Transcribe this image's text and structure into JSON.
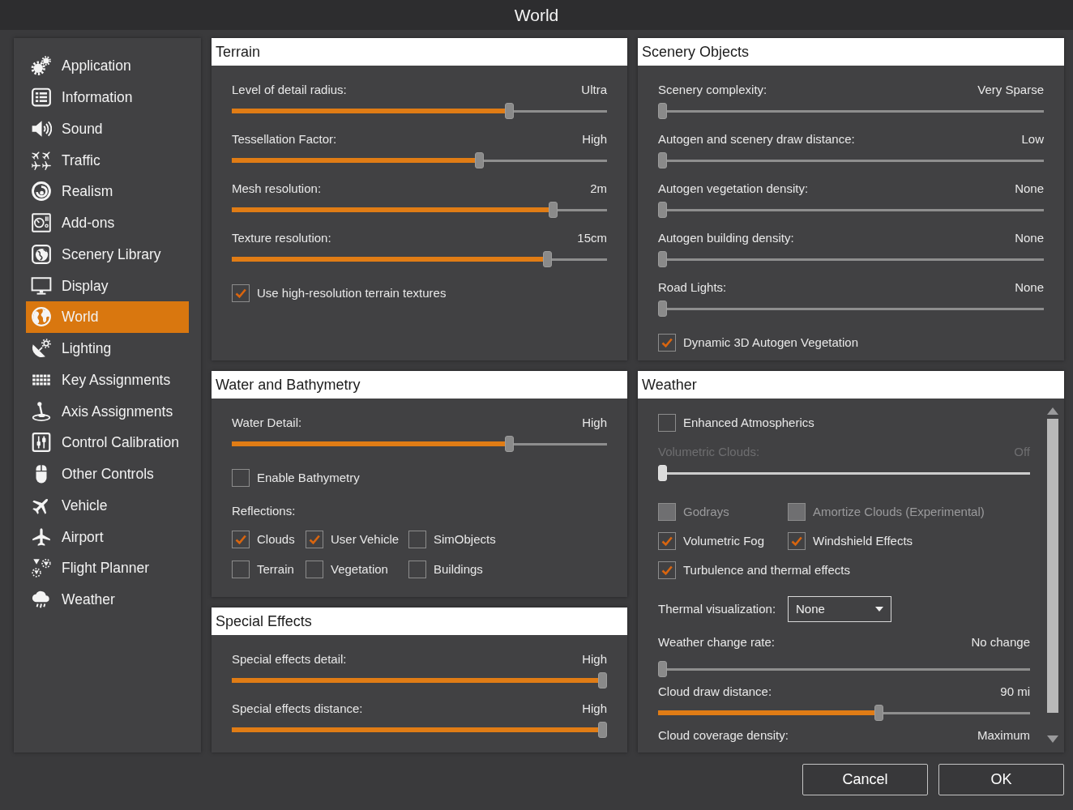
{
  "window": {
    "title": "World"
  },
  "sidebar": {
    "items": [
      {
        "label": "Application",
        "selected": false
      },
      {
        "label": "Information",
        "selected": false
      },
      {
        "label": "Sound",
        "selected": false
      },
      {
        "label": "Traffic",
        "selected": false
      },
      {
        "label": "Realism",
        "selected": false
      },
      {
        "label": "Add-ons",
        "selected": false
      },
      {
        "label": "Scenery Library",
        "selected": false
      },
      {
        "label": "Display",
        "selected": false
      },
      {
        "label": "World",
        "selected": true
      },
      {
        "label": "Lighting",
        "selected": false
      },
      {
        "label": "Key Assignments",
        "selected": false
      },
      {
        "label": "Axis Assignments",
        "selected": false
      },
      {
        "label": "Control Calibration",
        "selected": false
      },
      {
        "label": "Other Controls",
        "selected": false
      },
      {
        "label": "Vehicle",
        "selected": false
      },
      {
        "label": "Airport",
        "selected": false
      },
      {
        "label": "Flight Planner",
        "selected": false
      },
      {
        "label": "Weather",
        "selected": false
      }
    ]
  },
  "columns": [
    {
      "panels": [
        {
          "title": "Terrain",
          "controls": [
            {
              "kind": "slider",
              "label": "Level of detail radius:",
              "value": "Ultra",
              "level": 0.745
            },
            {
              "kind": "slider",
              "label": "Tessellation Factor:",
              "value": "High",
              "level": 0.663
            },
            {
              "kind": "slider",
              "label": "Mesh resolution:",
              "value": "2m",
              "level": 0.866
            },
            {
              "kind": "slider",
              "label": "Texture resolution:",
              "value": "15cm",
              "level": 0.849
            },
            {
              "kind": "checkbox",
              "label": "Use high-resolution terrain textures",
              "checked": true
            }
          ]
        },
        {
          "title": "Water and Bathymetry",
          "controls": [
            {
              "kind": "slider",
              "label": "Water Detail:",
              "value": "High",
              "level": 0.745
            },
            {
              "kind": "checkbox",
              "label": "Enable Bathymetry",
              "checked": false
            },
            {
              "kind": "heading",
              "label": "Reflections:"
            },
            {
              "kind": "checkbox_grid",
              "items": [
                {
                  "label": "Clouds",
                  "checked": true
                },
                {
                  "label": "User Vehicle",
                  "checked": true
                },
                {
                  "label": "SimObjects",
                  "checked": false
                },
                {
                  "label": "Terrain",
                  "checked": false
                },
                {
                  "label": "Vegetation",
                  "checked": false
                },
                {
                  "label": "Buildings",
                  "checked": false
                }
              ]
            }
          ]
        },
        {
          "title": "Special Effects",
          "controls": [
            {
              "kind": "slider",
              "label": "Special effects detail:",
              "value": "High",
              "level": 1
            },
            {
              "kind": "slider",
              "label": "Special effects distance:",
              "value": "High",
              "level": 1
            }
          ]
        }
      ]
    },
    {
      "panels": [
        {
          "title": "Scenery Objects",
          "controls": [
            {
              "kind": "slider",
              "label": "Scenery complexity:",
              "value": "Very Sparse",
              "level": 0
            },
            {
              "kind": "slider",
              "label": "Autogen and scenery draw distance:",
              "value": "Low",
              "level": 0
            },
            {
              "kind": "slider",
              "label": "Autogen vegetation density:",
              "value": "None",
              "level": 0
            },
            {
              "kind": "slider",
              "label": "Autogen building density:",
              "value": "None",
              "level": 0
            },
            {
              "kind": "slider",
              "label": "Road Lights:",
              "value": "None",
              "level": 0
            },
            {
              "kind": "checkbox",
              "label": "Dynamic 3D Autogen Vegetation",
              "checked": true
            }
          ]
        },
        {
          "title": "Weather",
          "scrollable": true,
          "controls": [
            {
              "kind": "checkbox",
              "label": "Enhanced Atmospherics",
              "checked": false,
              "disabled": false
            },
            {
              "kind": "slider",
              "label": "Volumetric Clouds:",
              "value": "Off",
              "level": 0,
              "disabled": true
            },
            {
              "kind": "checkbox_row",
              "items": [
                {
                  "label": "Godrays",
                  "checked": false,
                  "disabled": true
                },
                {
                  "label": "Amortize Clouds (Experimental)",
                  "checked": false,
                  "disabled": true
                }
              ]
            },
            {
              "kind": "checkbox_row",
              "items": [
                {
                  "label": "Volumetric Fog",
                  "checked": true,
                  "disabled": false
                },
                {
                  "label": "Windshield Effects",
                  "checked": true,
                  "disabled": false
                }
              ]
            },
            {
              "kind": "checkbox",
              "label": "Turbulence and thermal effects",
              "checked": true,
              "disabled": false
            },
            {
              "kind": "dropdown",
              "label": "Thermal visualization:",
              "value": "None"
            },
            {
              "kind": "slider_inline",
              "label": "Weather change rate:",
              "value": "No change",
              "level": 0,
              "disabled": false
            },
            {
              "kind": "slider",
              "label": "Cloud draw distance:",
              "value": "90 mi",
              "level": 0.595,
              "disabled": false
            },
            {
              "kind": "text_row",
              "label": "Cloud coverage density:",
              "value": "Maximum"
            }
          ]
        }
      ]
    }
  ],
  "buttons": [
    {
      "label": "Cancel"
    },
    {
      "label": "OK"
    }
  ]
}
